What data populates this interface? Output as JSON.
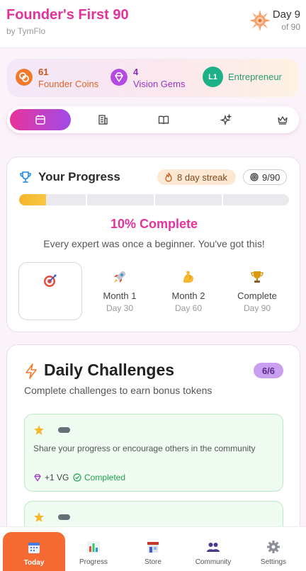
{
  "header": {
    "title": "Founder's First 90",
    "subtitle": "by TymFlo",
    "day_label": "Day 9",
    "day_of": "of 90"
  },
  "stats": {
    "coins_value": "61",
    "coins_label": "Founder Coins",
    "gems_value": "4",
    "gems_label": "Vision Gems",
    "level_badge": "L1",
    "level_label": "Entrepreneur"
  },
  "tabs": [
    {
      "icon": "calendar-icon",
      "active": true
    },
    {
      "icon": "building-icon",
      "active": false
    },
    {
      "icon": "book-icon",
      "active": false
    },
    {
      "icon": "sparkle-icon",
      "active": false
    },
    {
      "icon": "crown-icon",
      "active": false
    }
  ],
  "progress": {
    "title": "Your Progress",
    "streak": "8 day streak",
    "count": "9/90",
    "fraction_complete": 0.1,
    "percent_label": "10% Complete",
    "motivation": "Every expert was once a beginner. You've got this!",
    "milestones": [
      {
        "name": "Month 1",
        "day": "Day 30",
        "icon": "rocket-icon"
      },
      {
        "name": "Month 2",
        "day": "Day 60",
        "icon": "flexed-arm-icon"
      },
      {
        "name": "Complete",
        "day": "Day 90",
        "icon": "trophy-icon"
      }
    ]
  },
  "challenges": {
    "title": "Daily Challenges",
    "badge": "6/6",
    "subtitle": "Complete challenges to earn bonus tokens",
    "items": [
      {
        "description": "Share your progress or encourage others in the community",
        "reward": "+1 VG",
        "status": "Completed"
      }
    ]
  },
  "nav": [
    {
      "label": "Today",
      "icon": "calendar-icon",
      "active": true
    },
    {
      "label": "Progress",
      "icon": "bar-chart-icon",
      "active": false
    },
    {
      "label": "Store",
      "icon": "store-icon",
      "active": false
    },
    {
      "label": "Community",
      "icon": "people-icon",
      "active": false
    },
    {
      "label": "Settings",
      "icon": "gear-icon",
      "active": false
    }
  ],
  "colors": {
    "brand_pink": "#e5329a",
    "brand_purple": "#a04be6",
    "accent_orange": "#f56a33",
    "success_green": "#22a04a"
  }
}
